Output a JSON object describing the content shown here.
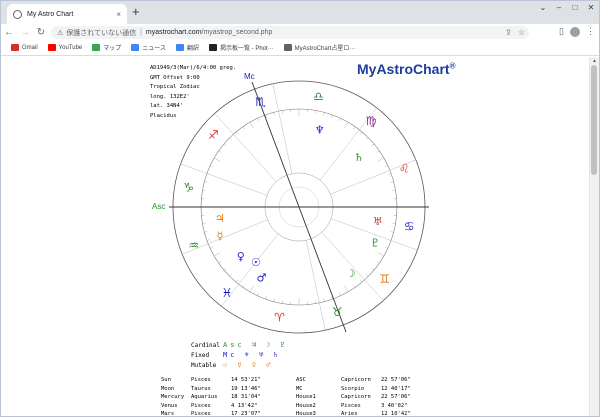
{
  "browser": {
    "tab_title": "My Astro Chart",
    "tab_close": "×",
    "new_tab": "+",
    "url_label": "保護されていない通信",
    "url_host": "myastrochart.com",
    "url_path": "/myastrop_second.php",
    "bookmarks": [
      {
        "label": "Gmail",
        "icon": "gmail-icon",
        "color": "#d93025"
      },
      {
        "label": "YouTube",
        "icon": "youtube-icon",
        "color": "#ff0000"
      },
      {
        "label": "マップ",
        "icon": "maps-icon",
        "color": "#34a853"
      },
      {
        "label": "ニュース",
        "icon": "news-icon",
        "color": "#4285f4"
      },
      {
        "label": "翻訳",
        "icon": "translate-icon",
        "color": "#4285f4"
      },
      {
        "label": "掲示板一覧 - Phot···",
        "icon": "camera-icon",
        "color": "#202124"
      },
      {
        "label": "MyAstroChart占星ロ···",
        "icon": "globe-icon",
        "color": "#5f6368"
      }
    ]
  },
  "page": {
    "brand": "MyAstroChart",
    "brand_mark": "®",
    "info_lines": [
      "AD1949/3(Mar)/6/4:00 greg.",
      "GMT Offset 9:00",
      "Tropical Zodiac",
      "long. 132E2'",
      "lat. 34N4'",
      "Placidus"
    ]
  },
  "chart_data": {
    "type": "astrological-wheel",
    "angles": {
      "asc_label": "Asc",
      "mc_label": "Mc"
    },
    "signs_on_wheel": [
      "♎",
      "♍",
      "♌",
      "♋",
      "♊",
      "♉",
      "♈",
      "♓",
      "♒",
      "♑",
      "♐",
      "♏"
    ],
    "planet_glyphs": [
      "♄",
      "☽",
      "♂",
      "☉",
      "♀",
      "♃",
      "☿",
      "♆",
      "♅",
      "♇"
    ]
  },
  "legend": {
    "rows": [
      {
        "label": "Cardinal",
        "symbols": "Asc ♃ ☽ ♇"
      },
      {
        "label": "Fixed",
        "symbols": "Mc ♆ ♅ ♄"
      },
      {
        "label": "Mutable",
        "symbols": "☉ ☿ ♀ ♂"
      }
    ]
  },
  "positions": [
    {
      "p": "Sun",
      "sign": "Pisces",
      "deg": "14 53'21\"",
      "h": "ASC",
      "hsign": "Capricorn",
      "hdeg": "22 57'06\""
    },
    {
      "p": "Moon",
      "sign": "Taurus",
      "deg": "19 13'46\"",
      "h": "MC",
      "hsign": "Scorpio",
      "hdeg": "12 40'17\""
    },
    {
      "p": "Mercury",
      "sign": "Aquarius",
      "deg": "18 31'04\"",
      "h": "House1",
      "hsign": "Capricorn",
      "hdeg": "22 57'06\""
    },
    {
      "p": "Venus",
      "sign": "Pisces",
      "deg": "4 13'42\"",
      "h": "House2",
      "hsign": "Pisces",
      "hdeg": "3 40'02\""
    },
    {
      "p": "Mars",
      "sign": "Pisces",
      "deg": "17 23'07\"",
      "h": "House3",
      "hsign": "Aries",
      "hdeg": "12 10'42\""
    }
  ]
}
